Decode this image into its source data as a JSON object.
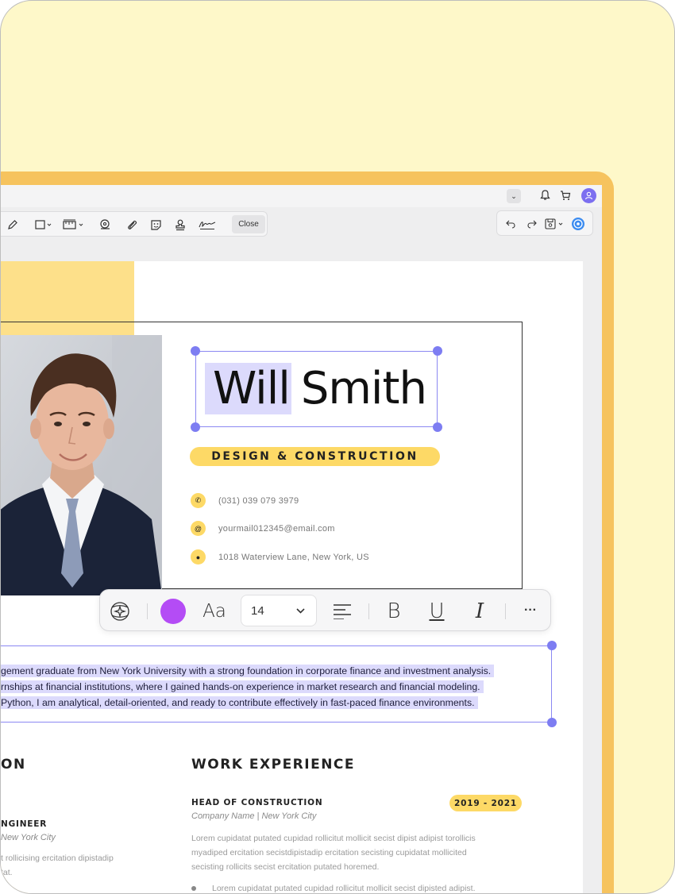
{
  "toolbar": {
    "close_label": "Close"
  },
  "resume": {
    "first_name": "Will",
    "last_name": "Smith",
    "title": "DESIGN & CONSTRUCTION",
    "contacts": [
      {
        "icon": "phone-icon",
        "text": "(031)  039  079  3979"
      },
      {
        "icon": "email-icon",
        "text": "yourmail012345@email.com"
      },
      {
        "icon": "location-icon",
        "text": "1018 Waterview Lane, New York, US"
      }
    ],
    "summary": [
      "gement graduate from New York University with a strong foundation in corporate finance and investment analysis.",
      "rnships at financial institutions, where I gained hands-on experience in market research and financial modeling.",
      " Python, I am analytical, detail-oriented, and ready to contribute effectively in fast-paced finance environments."
    ],
    "left_section_title": "ON",
    "left_job_title": "NGINEER",
    "left_job_company": "New York City",
    "left_job_body": [
      "t rollicising ercitation dipistadip",
      "tat."
    ],
    "work_title": "WORK EXPERIENCE",
    "job_title": "HEAD OF CONSTRUCTION",
    "job_dates": "2019 - 2021",
    "job_company": "Company Name | New York City",
    "job_body": [
      "Lorem cupidatat putated cupidad rollicitut mollicit secist dipist adipist torollicis",
      "myadiped ercitation secistdipistadip ercitation secisting cupidatat mollicited",
      "secisting rollicits secist ercitation putated horemed."
    ],
    "job_bullet": "Lorem cupidatat putated cupidad rollicitut mollicit secist dipisted adipist."
  },
  "format_bar": {
    "font_size": "14",
    "font_label": "Aa",
    "text_color": "#b44cf5",
    "bold": "B",
    "underline": "U",
    "italic": "I",
    "more": "···"
  },
  "colors": {
    "accent_yellow": "#fdd966",
    "selection": "#dcdafc",
    "handle": "#7d7df2",
    "background": "#fef8c9"
  }
}
